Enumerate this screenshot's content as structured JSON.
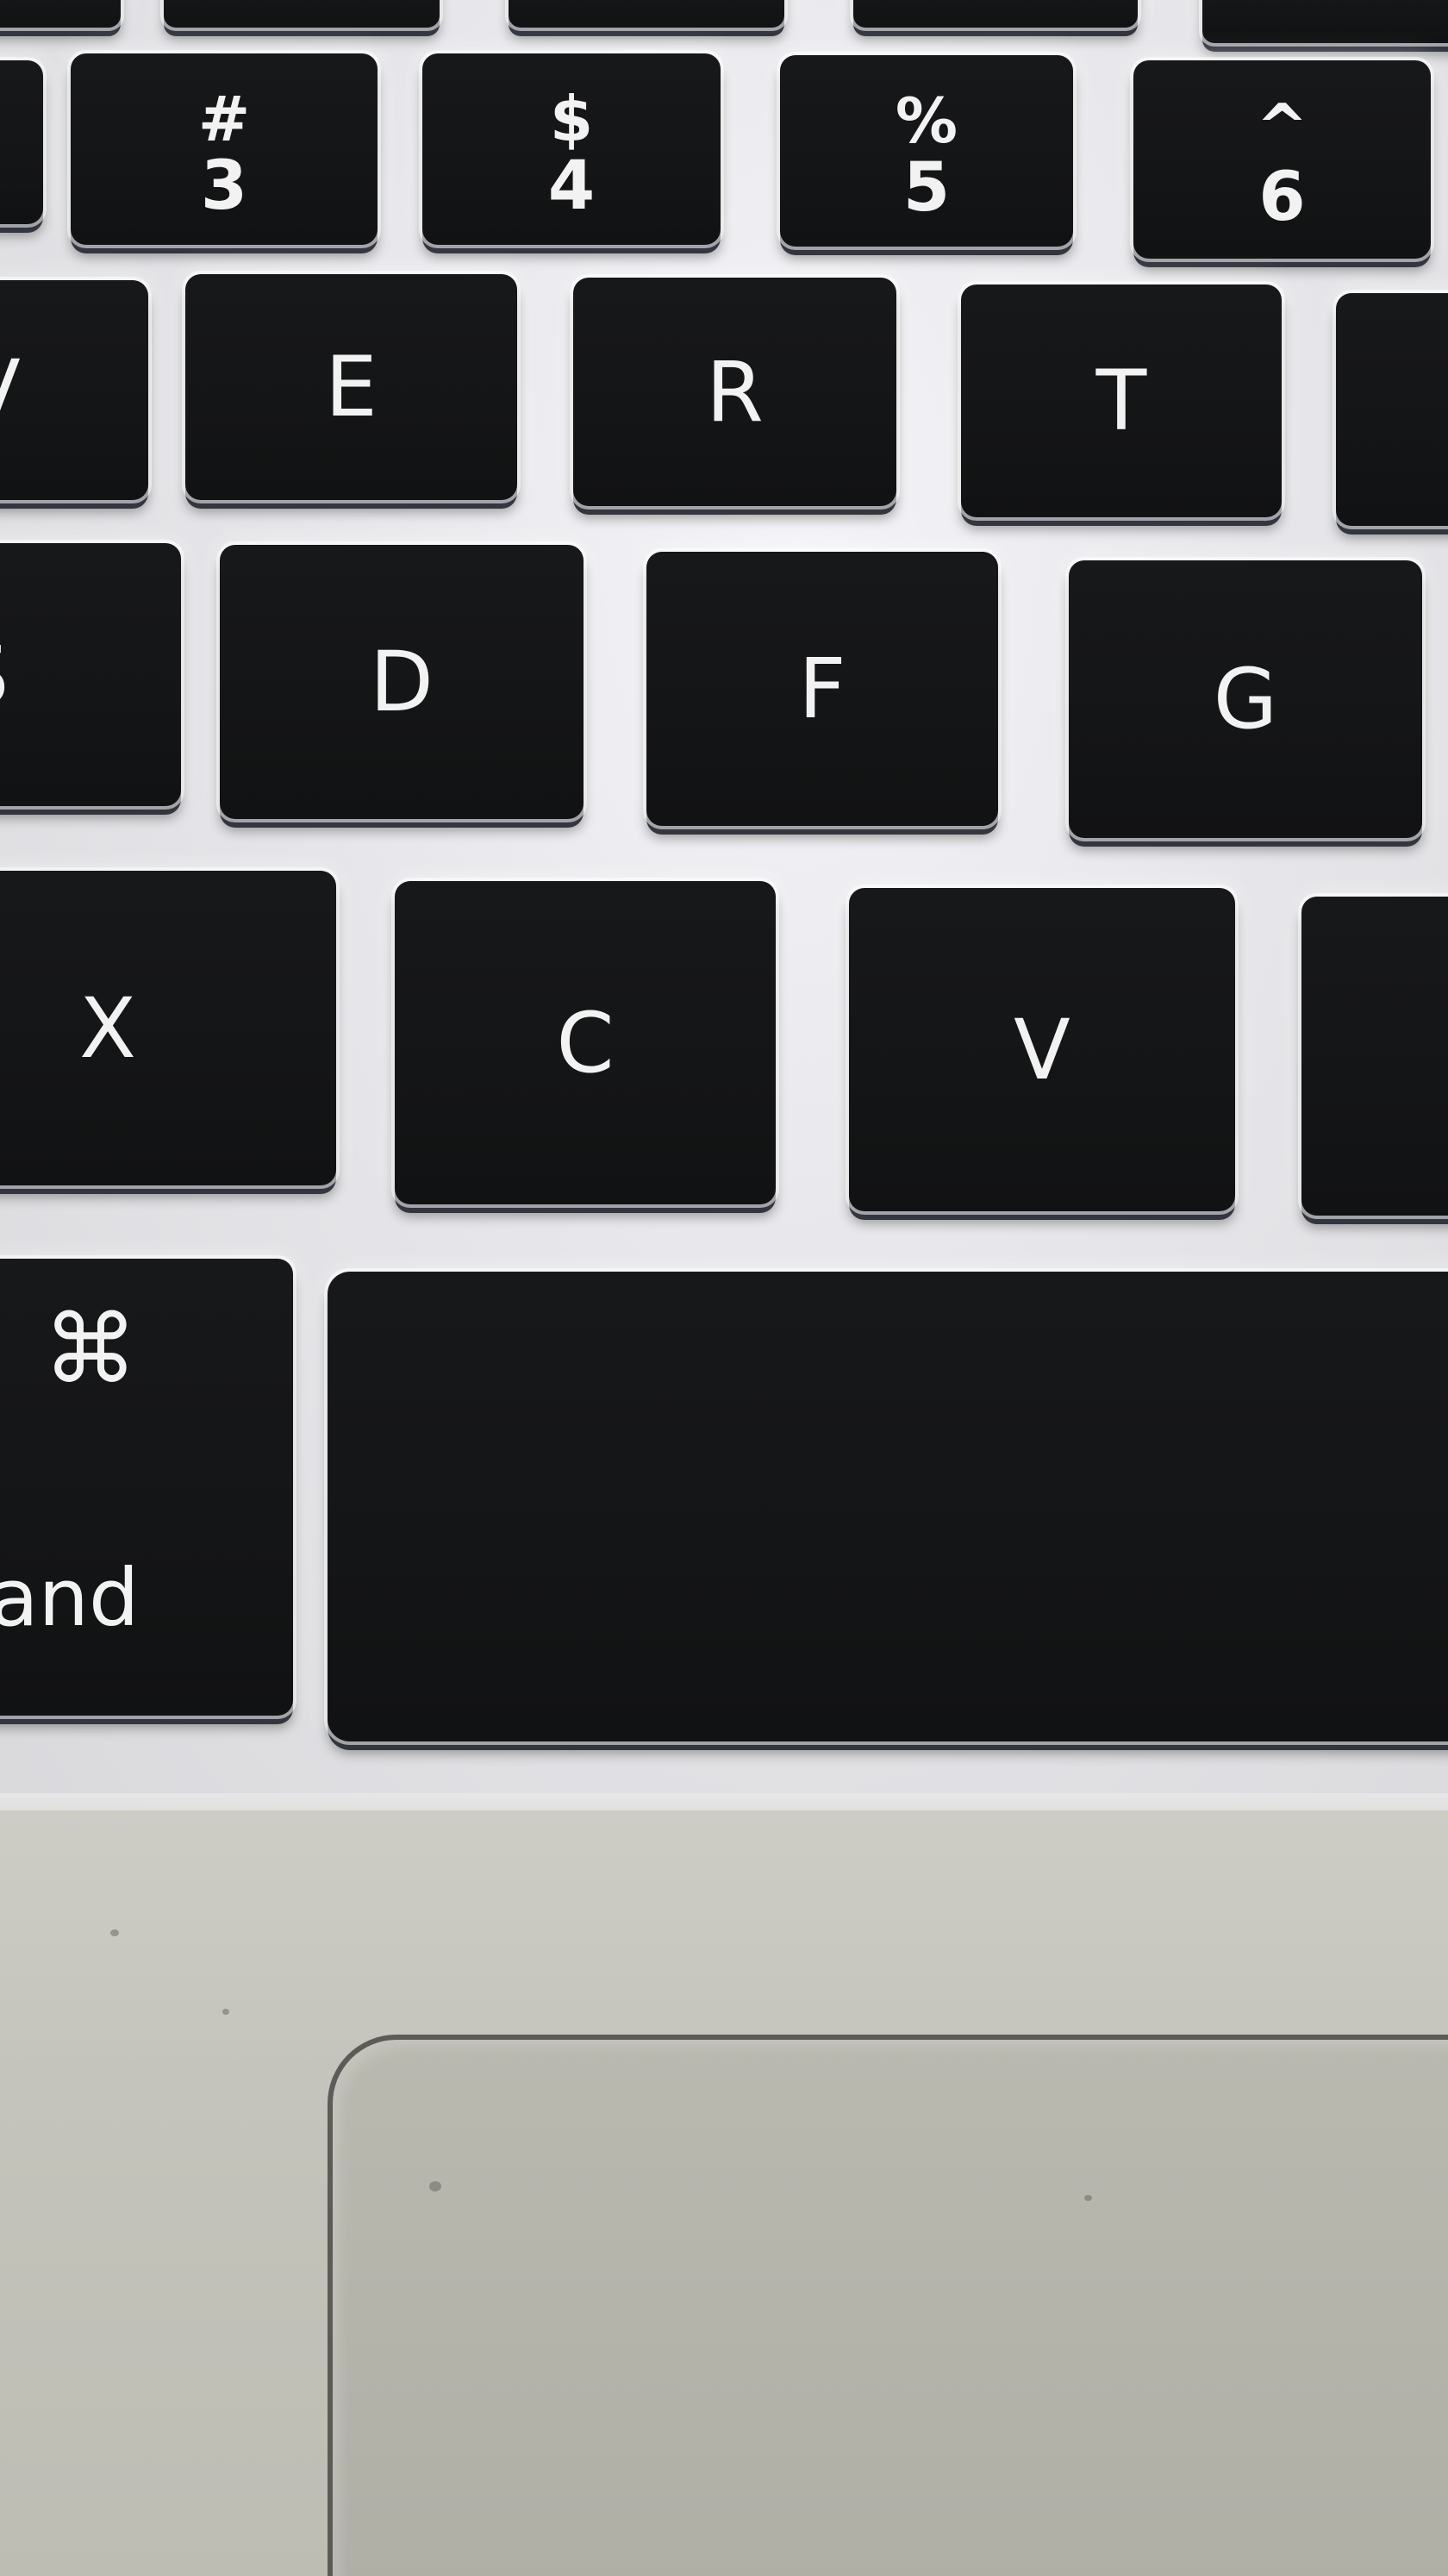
{
  "keyboard": {
    "number_row": [
      {
        "name": "key-3",
        "shift": "#",
        "main": "3"
      },
      {
        "name": "key-4",
        "shift": "$",
        "main": "4"
      },
      {
        "name": "key-5",
        "shift": "%",
        "main": "5"
      },
      {
        "name": "key-6",
        "shift": "^",
        "main": "6"
      }
    ],
    "top_row": [
      "E",
      "R",
      "T"
    ],
    "home_row": [
      "D",
      "F",
      "G"
    ],
    "bottom_row": [
      "X",
      "C",
      "V"
    ],
    "partial_left": {
      "w": "V",
      "s": "S"
    },
    "command_key": {
      "glyph": "⌘",
      "word": "nand"
    },
    "spacebar": {
      "label": ""
    }
  }
}
